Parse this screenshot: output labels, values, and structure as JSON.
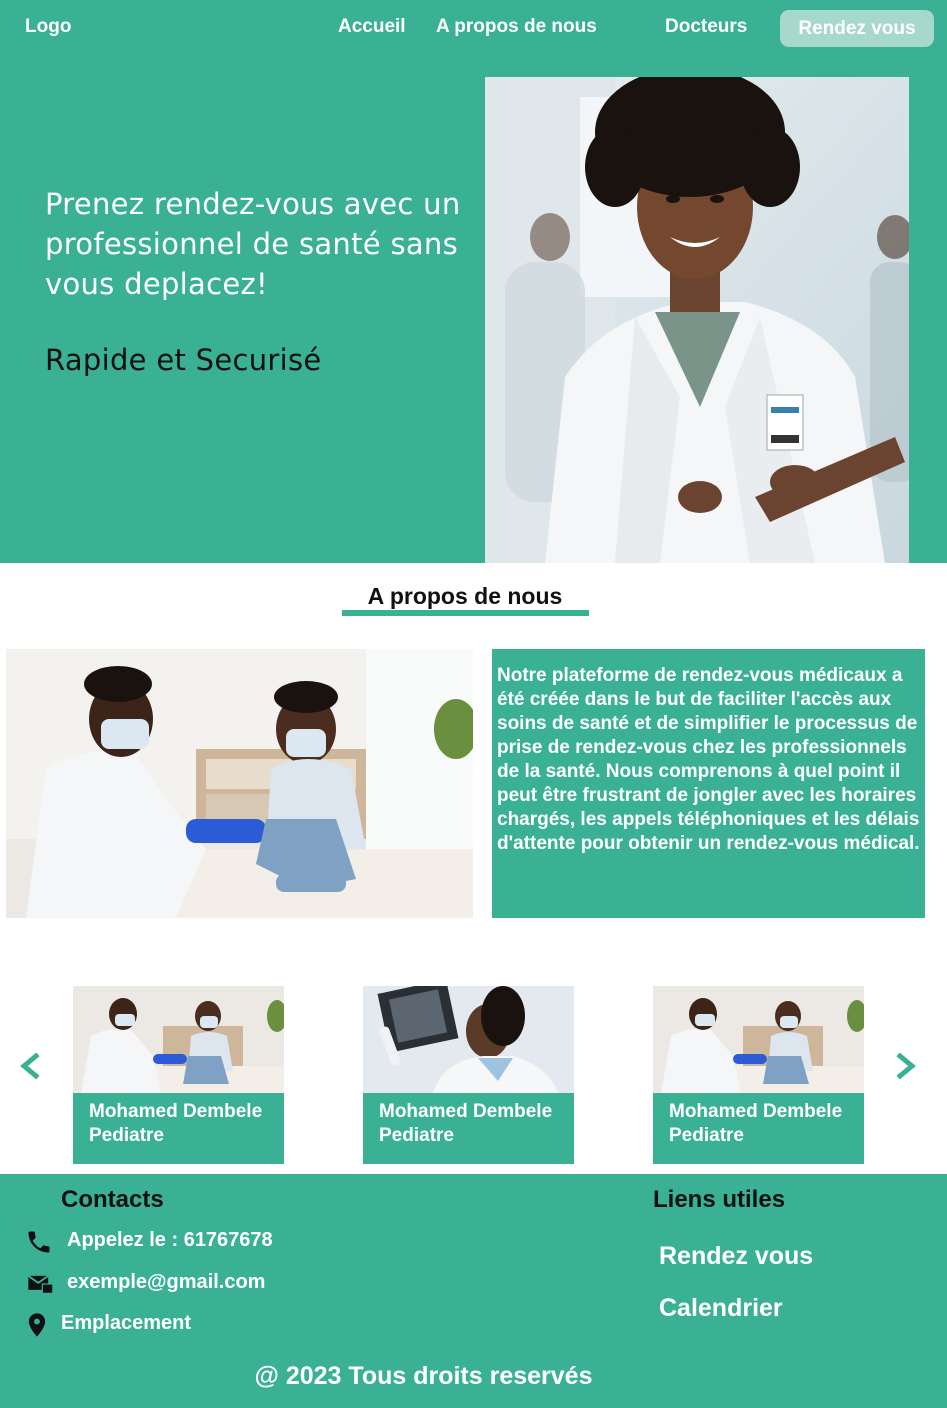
{
  "nav": {
    "logo": "Logo",
    "items": [
      "Accueil",
      "A propos de nous",
      "Docteurs"
    ],
    "cta": "Rendez vous"
  },
  "hero": {
    "title": "Prenez rendez-vous avec un professionnel de santé sans vous deplacez!",
    "subtitle": "Rapide et Securisé"
  },
  "about": {
    "title": "A propos de nous",
    "text": "Notre plateforme de rendez-vous médicaux a été créée dans le but de faciliter l'accès aux soins de santé et de simplifier le processus de prise de rendez-vous chez les professionnels de la santé. Nous comprenons à quel point il peut être frustrant de jongler avec les horaires chargés, les appels téléphoniques et les délais d'attente pour obtenir un rendez-vous médical."
  },
  "doctors": [
    {
      "name": "Mohamed Dembele",
      "specialty": "Pediatre"
    },
    {
      "name": "Mohamed Dembele",
      "specialty": "Pediatre"
    },
    {
      "name": "Mohamed Dembele",
      "specialty": "Pediatre"
    }
  ],
  "footer": {
    "contacts_title": "Contacts",
    "phone": "Appelez le : 61767678",
    "email": "exemple@gmail.com",
    "location": "Emplacement",
    "links_title": "Liens utiles",
    "links": [
      "Rendez vous",
      "Calendrier"
    ],
    "copyright": "@ 2023 Tous droits reservés"
  },
  "icons": {
    "prev": "chevron-left-icon",
    "next": "chevron-right-icon",
    "phone": "phone-icon",
    "email": "email-icon",
    "location": "location-pin-icon"
  },
  "colors": {
    "accent": "#3ab195",
    "nav_button": "#a7d8cc",
    "dark_text": "#111111"
  }
}
